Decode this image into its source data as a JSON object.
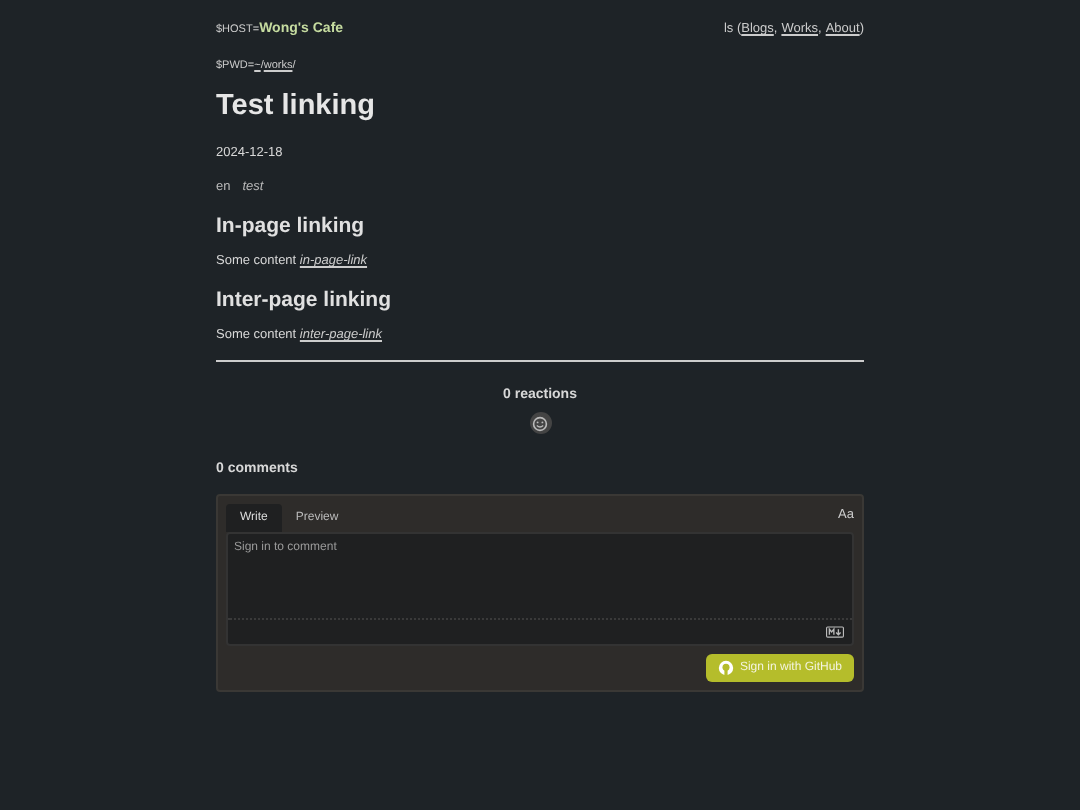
{
  "header": {
    "host_label": "$HOST=",
    "site_name": "Wong's Cafe",
    "nav_prefix": "ls (",
    "nav_separator": ",",
    "nav_suffix": ")",
    "nav": [
      {
        "label": "Blogs"
      },
      {
        "label": "Works"
      },
      {
        "label": "About"
      }
    ]
  },
  "path": {
    "label": "$PWD=",
    "segments": [
      {
        "label": "~"
      },
      {
        "label": "works"
      }
    ],
    "separator": "/"
  },
  "post": {
    "title": "Test linking",
    "date": "2024-12-18",
    "tags": [
      {
        "label": "en",
        "kind": "lang"
      },
      {
        "label": "test",
        "kind": "tag"
      }
    ],
    "sections": [
      {
        "heading": "In-page linking",
        "text": "Some content",
        "link": "in-page-link"
      },
      {
        "heading": "Inter-page linking",
        "text": "Some content",
        "link": "inter-page-link"
      }
    ]
  },
  "reactions": {
    "count_label": "0 reactions"
  },
  "comments": {
    "count_label": "0 comments",
    "tabs": [
      {
        "label": "Write",
        "selected": true
      },
      {
        "label": "Preview",
        "selected": false
      }
    ],
    "format_label": "Aa",
    "placeholder": "Sign in to comment",
    "button": "Sign in with GitHub"
  }
}
